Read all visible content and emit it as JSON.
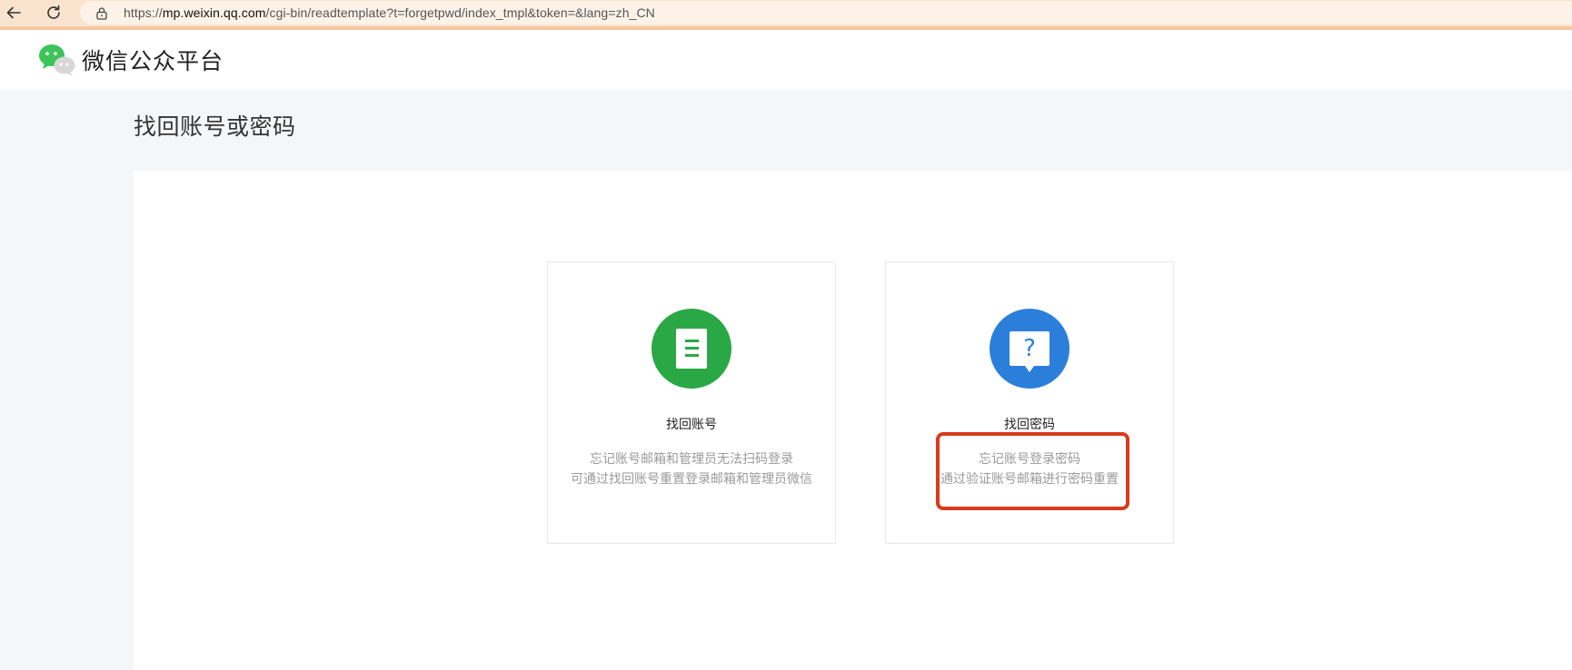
{
  "browser": {
    "url_prefix": "https://",
    "url_host": "mp.weixin.qq.com",
    "url_path": "/cgi-bin/readtemplate?t=forgetpwd/index_tmpl&token=&lang=zh_CN"
  },
  "header": {
    "brand": "微信公众平台"
  },
  "page": {
    "title": "找回账号或密码"
  },
  "cards": [
    {
      "title": "找回账号",
      "desc_line1": "忘记账号邮箱和管理员无法扫码登录",
      "desc_line2": "可通过找回账号重置登录邮箱和管理员微信",
      "icon": "document-icon",
      "color": "#2aa845"
    },
    {
      "title": "找回密码",
      "desc_line1": "忘记账号登录密码",
      "desc_line2": "通过验证账号邮箱进行密码重置",
      "icon": "question-icon",
      "icon_glyph": "?",
      "color": "#2b7fdb"
    }
  ],
  "colors": {
    "browser_bar": "#fbe4cf",
    "highlight": "#d93a1c",
    "page_bg": "#f5f6f7"
  }
}
